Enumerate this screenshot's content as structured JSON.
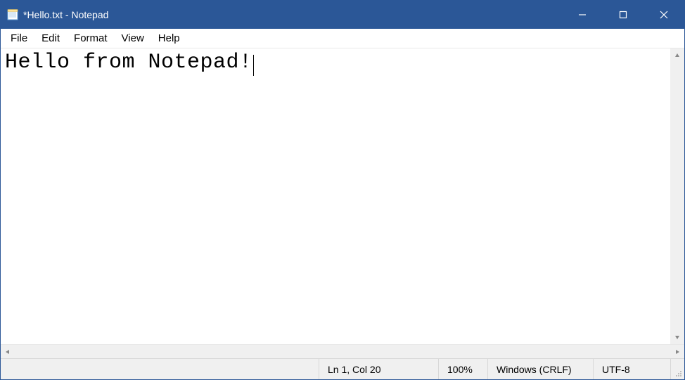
{
  "titlebar": {
    "title": "*Hello.txt - Notepad"
  },
  "menubar": {
    "items": [
      {
        "label": "File"
      },
      {
        "label": "Edit"
      },
      {
        "label": "Format"
      },
      {
        "label": "View"
      },
      {
        "label": "Help"
      }
    ]
  },
  "editor": {
    "content": "Hello from Notepad!"
  },
  "statusbar": {
    "position": "Ln 1, Col 20",
    "zoom": "100%",
    "eol": "Windows (CRLF)",
    "encoding": "UTF-8"
  }
}
